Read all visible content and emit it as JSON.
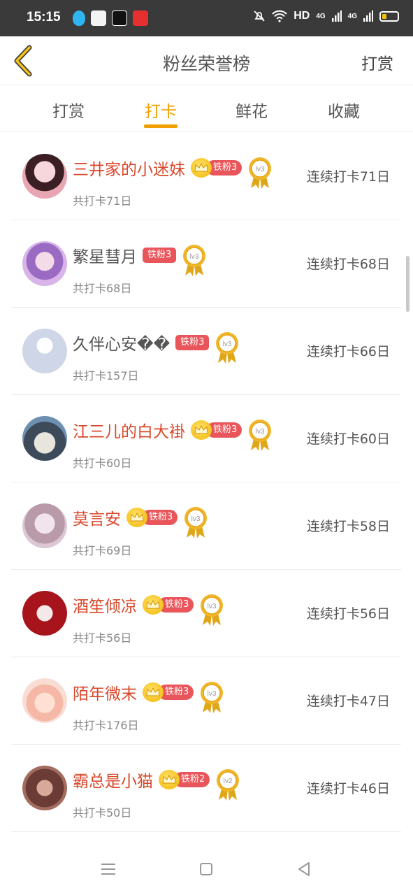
{
  "status_bar": {
    "time": "15:15",
    "network": "HD",
    "signal_1": "4G",
    "signal_2": "4G",
    "battery_level": 0.3,
    "app_icons": [
      "qq-icon",
      "mail-app-icon",
      "tiktok-icon",
      "video-app-icon"
    ]
  },
  "header": {
    "title": "粉丝荣誉榜",
    "action_label": "打赏"
  },
  "tabs": [
    {
      "label": "打赏"
    },
    {
      "label": "打卡"
    },
    {
      "label": "鲜花"
    },
    {
      "label": "收藏"
    }
  ],
  "active_tab": "打卡",
  "colors": {
    "accent": "#f0a000",
    "vip_name": "#d9482b",
    "fan_badge": "#e8555a"
  },
  "fans": [
    {
      "name": "三井家的小迷妹",
      "vip": true,
      "fan_level": "铁粉3",
      "medal": "lv3",
      "total": "共打卡71日",
      "streak": "连续打卡71日"
    },
    {
      "name": "繁星彗月",
      "vip": false,
      "fan_level": "铁粉3",
      "medal": "lv3",
      "total": "共打卡68日",
      "streak": "连续打卡68日"
    },
    {
      "name": "久伴心安��",
      "vip": false,
      "fan_level": "铁粉3",
      "medal": "lv3",
      "total": "共打卡157日",
      "streak": "连续打卡66日"
    },
    {
      "name": "江三儿的白大褂",
      "vip": true,
      "fan_level": "铁粉3",
      "medal": "lv3",
      "total": "共打卡60日",
      "streak": "连续打卡60日"
    },
    {
      "name": "莫言安",
      "vip": true,
      "fan_level": "铁粉3",
      "medal": "lv3",
      "total": "共打卡69日",
      "streak": "连续打卡58日"
    },
    {
      "name": "酒笙倾凉",
      "vip": true,
      "fan_level": "铁粉3",
      "medal": "lv3",
      "total": "共打卡56日",
      "streak": "连续打卡56日"
    },
    {
      "name": "陌年微末",
      "vip": true,
      "fan_level": "铁粉3",
      "medal": "lv3",
      "total": "共打卡176日",
      "streak": "连续打卡47日"
    },
    {
      "name": "霸总是小猫",
      "vip": true,
      "fan_level": "铁粉2",
      "medal": "lv2",
      "total": "共打卡50日",
      "streak": "连续打卡46日"
    }
  ]
}
